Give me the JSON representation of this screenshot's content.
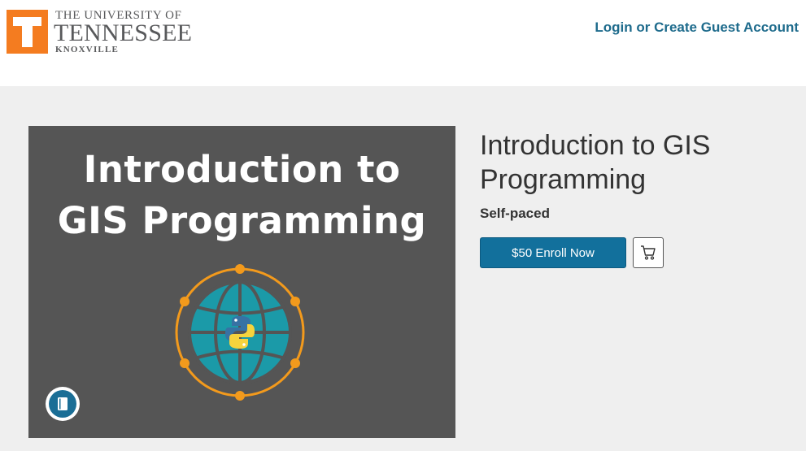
{
  "header": {
    "logo": {
      "line1": "THE UNIVERSITY OF",
      "line2": "TENNESSEE",
      "line3": "KNOXVILLE",
      "icon": "power-t-icon",
      "orange": "#f47c20"
    },
    "login_link": "Login or Create Guest Account"
  },
  "hero": {
    "title_line1": "Introduction to",
    "title_line2": "GIS Programming",
    "graphic": "globe-python-icon",
    "badge_icon": "book-icon",
    "background": "#555555"
  },
  "course": {
    "title": "Introduction to GIS Programming",
    "pace": "Self-paced",
    "enroll_label": "$50 Enroll Now",
    "cart_icon": "cart-icon",
    "accent": "#12709c"
  }
}
